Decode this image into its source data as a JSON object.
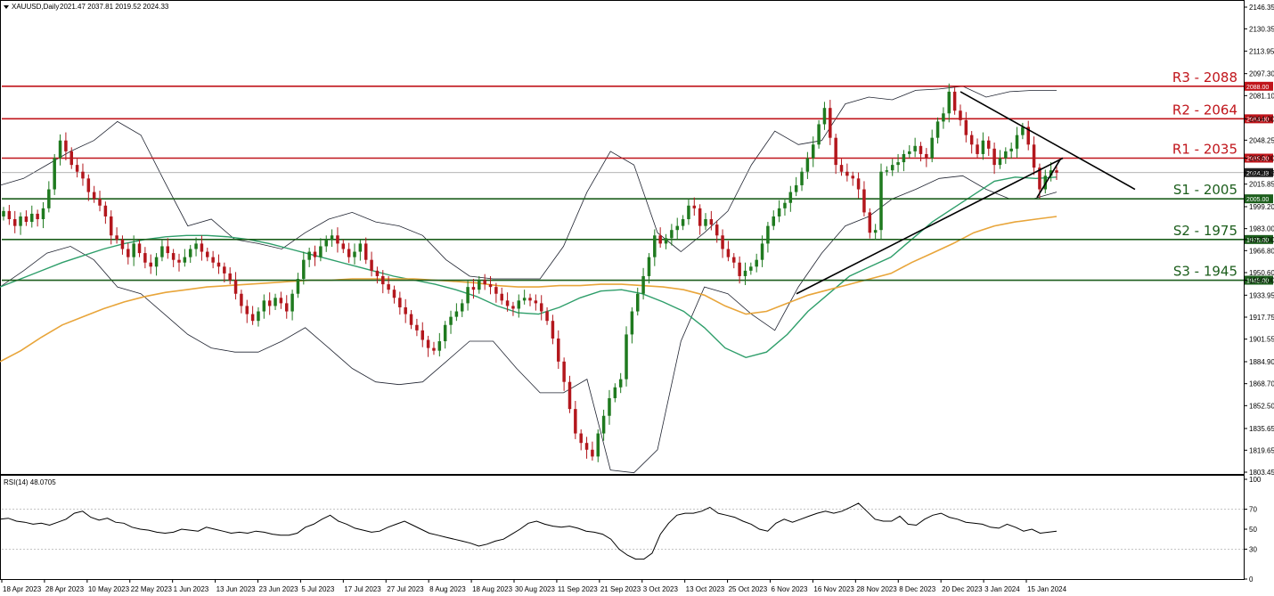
{
  "header": {
    "symbol": "XAUUSD,Daily",
    "ohlc": "2021.47 2037.81 2019.52 2024.33",
    "rsi_label": "RSI(14) 48.0705"
  },
  "colors": {
    "resistance": "#c0151b",
    "support": "#1c5e1c",
    "ma_green": "#2e9e6a",
    "ma_orange": "#e8a53a",
    "bollinger": "#1f2330",
    "bull": "#1f7a1f",
    "bear": "#b3171d",
    "last_price_bg": "#222222"
  },
  "chart_data": [
    {
      "type": "candlestick",
      "title": "XAUUSD,Daily",
      "ylim": [
        1803.45,
        2146.35
      ],
      "y_ticks": [
        "2146.35",
        "2130.35",
        "2113.95",
        "2097.30",
        "2081.10",
        "2064.00",
        "2048.25",
        "2035.00",
        "2024.33",
        "2015.85",
        "1999.20",
        "1983.00",
        "1975.00",
        "1966.80",
        "1950.60",
        "1945.00",
        "1933.95",
        "1917.75",
        "1901.55",
        "1884.90",
        "1868.70",
        "1852.50",
        "1835.65",
        "1819.65",
        "1803.45"
      ],
      "x_tick_labels": [
        "18 Apr 2023",
        "28 Apr 2023",
        "10 May 2023",
        "22 May 2023",
        "1 Jun 2023",
        "13 Jun 2023",
        "23 Jun 2023",
        "5 Jul 2023",
        "17 Jul 2023",
        "27 Jul 2023",
        "8 Aug 2023",
        "18 Aug 2023",
        "30 Aug 2023",
        "11 Sep 2023",
        "21 Sep 2023",
        "3 Oct 2023",
        "13 Oct 2023",
        "25 Oct 2023",
        "6 Nov 2023",
        "16 Nov 2023",
        "28 Nov 2023",
        "8 Dec 2023",
        "20 Dec 2023",
        "3 Jan 2024",
        "15 Jan 2024"
      ],
      "levels": [
        {
          "label": "R3 - 2088",
          "value": 2088,
          "badge": "2088.00",
          "kind": "resistance"
        },
        {
          "label": "R2 - 2064",
          "value": 2064,
          "badge": "2064.00",
          "kind": "resistance"
        },
        {
          "label": "R1 - 2035",
          "value": 2035,
          "badge": "2035.00",
          "kind": "resistance"
        },
        {
          "label": "S1 - 2005",
          "value": 2005,
          "badge": "2005.00",
          "kind": "support"
        },
        {
          "label": "S2 - 1975",
          "value": 1975,
          "badge": "1975.00",
          "kind": "support"
        },
        {
          "label": "S3 - 1945",
          "value": 1945,
          "badge": "1945.00",
          "kind": "support"
        }
      ],
      "last_price": 2024.33,
      "closes": [
        1996,
        1990,
        1985,
        1992,
        1988,
        1994,
        1990,
        1998,
        2012,
        2035,
        2048,
        2040,
        2030,
        2025,
        2020,
        2010,
        2005,
        2000,
        1992,
        1978,
        1975,
        1968,
        1962,
        1972,
        1965,
        1958,
        1955,
        1962,
        1970,
        1965,
        1960,
        1958,
        1962,
        1968,
        1972,
        1966,
        1962,
        1958,
        1955,
        1950,
        1945,
        1935,
        1926,
        1920,
        1915,
        1922,
        1930,
        1926,
        1932,
        1928,
        1922,
        1935,
        1946,
        1960,
        1966,
        1962,
        1970,
        1975,
        1978,
        1972,
        1968,
        1962,
        1966,
        1972,
        1960,
        1952,
        1948,
        1942,
        1938,
        1932,
        1925,
        1920,
        1912,
        1908,
        1901,
        1895,
        1893,
        1900,
        1912,
        1918,
        1922,
        1928,
        1940,
        1938,
        1945,
        1942,
        1940,
        1935,
        1930,
        1926,
        1924,
        1930,
        1932,
        1930,
        1928,
        1922,
        1915,
        1902,
        1885,
        1870,
        1850,
        1832,
        1825,
        1820,
        1815,
        1832,
        1845,
        1858,
        1866,
        1872,
        1905,
        1922,
        1935,
        1948,
        1962,
        1978,
        1972,
        1976,
        1982,
        1985,
        1990,
        2000,
        1998,
        1985,
        1990,
        1986,
        1978,
        1968,
        1962,
        1958,
        1948,
        1952,
        1955,
        1960,
        1972,
        1985,
        1992,
        1998,
        2002,
        2010,
        2015,
        2025,
        2035,
        2045,
        2060,
        2072,
        2050,
        2030,
        2025,
        2022,
        2020,
        2012,
        1995,
        1980,
        1982,
        2025,
        2026,
        2030,
        2032,
        2038,
        2040,
        2044,
        2038,
        2035,
        2050,
        2062,
        2068,
        2084,
        2070,
        2063,
        2052,
        2045,
        2038,
        2048,
        2042,
        2030,
        2035,
        2040,
        2042,
        2052,
        2058,
        2045,
        2028,
        2012,
        2022,
        2026,
        2024.33
      ],
      "ma_green": [
        1940,
        1946,
        1952,
        1958,
        1963,
        1968,
        1972,
        1975,
        1977,
        1978,
        1978,
        1977,
        1975,
        1972,
        1968,
        1964,
        1960,
        1956,
        1952,
        1948,
        1945,
        1942,
        1938,
        1933,
        1926,
        1921,
        1920,
        1925,
        1932,
        1937,
        1938,
        1935,
        1929,
        1922,
        1910,
        1895,
        1888,
        1892,
        1905,
        1922,
        1935,
        1948,
        1955,
        1962,
        1975,
        1988,
        1998,
        2008,
        2018,
        2021,
        2020,
        2021
      ],
      "ma_orange": [
        1885,
        1893,
        1903,
        1912,
        1918,
        1924,
        1929,
        1933,
        1936,
        1938,
        1940,
        1941,
        1942,
        1943,
        1944,
        1945,
        1945,
        1946,
        1946,
        1946,
        1946,
        1945,
        1944,
        1943,
        1941,
        1940,
        1940,
        1941,
        1941,
        1942,
        1942,
        1941,
        1940,
        1938,
        1934,
        1926,
        1920,
        1922,
        1928,
        1934,
        1938,
        1942,
        1946,
        1950,
        1958,
        1965,
        1972,
        1980,
        1985,
        1988,
        1990,
        1992
      ],
      "bb_upper": [
        2015,
        2020,
        2030,
        2040,
        2048,
        2062,
        2052,
        2018,
        1985,
        1990,
        1975,
        1972,
        1968,
        1980,
        1990,
        1995,
        1988,
        1985,
        1978,
        1960,
        1948,
        1946,
        1946,
        1946,
        1970,
        2010,
        2040,
        2030,
        1980,
        1966,
        1980,
        1996,
        2030,
        2055,
        2045,
        2048,
        2075,
        2080,
        2078,
        2085,
        2086,
        2088,
        2080,
        2084,
        2085,
        2085
      ],
      "bb_lower": [
        1940,
        1952,
        1965,
        1970,
        1960,
        1940,
        1935,
        1920,
        1905,
        1895,
        1892,
        1892,
        1900,
        1910,
        1895,
        1880,
        1870,
        1868,
        1870,
        1885,
        1900,
        1900,
        1880,
        1862,
        1862,
        1872,
        1805,
        1803,
        1820,
        1900,
        1940,
        1935,
        1920,
        1908,
        1940,
        1965,
        1985,
        1992,
        2005,
        2012,
        2020,
        2022,
        2012,
        2005,
        2005,
        2010
      ],
      "trendlines": [
        {
          "from": [
            2084,
            2070
          ],
          "to_value": 2012
        },
        {
          "from": [
            1935,
            1940
          ],
          "to_value": 2042
        }
      ]
    },
    {
      "type": "line",
      "title": "RSI(14) 48.0705",
      "ylim": [
        0,
        100
      ],
      "y_ticks": [
        "100",
        "70",
        "50",
        "30",
        "0"
      ],
      "values": [
        60,
        61,
        58,
        57,
        55,
        56,
        54,
        57,
        60,
        66,
        68,
        62,
        59,
        61,
        57,
        56,
        52,
        50,
        49,
        47,
        46,
        47,
        50,
        49,
        48,
        52,
        50,
        48,
        46,
        47,
        46,
        48,
        47,
        45,
        44,
        44,
        46,
        52,
        55,
        60,
        64,
        58,
        55,
        51,
        49,
        47,
        48,
        52,
        55,
        58,
        54,
        50,
        46,
        44,
        42,
        40,
        38,
        36,
        33,
        35,
        38,
        40,
        45,
        50,
        56,
        58,
        55,
        53,
        52,
        53,
        51,
        48,
        47,
        45,
        40,
        30,
        24,
        20,
        20,
        26,
        45,
        56,
        64,
        66,
        66,
        68,
        72,
        66,
        64,
        62,
        58,
        55,
        50,
        48,
        56,
        60,
        57,
        60,
        63,
        66,
        68,
        66,
        68,
        72,
        76,
        68,
        60,
        58,
        58,
        63,
        55,
        54,
        60,
        64,
        66,
        62,
        60,
        57,
        56,
        55,
        52,
        51,
        55,
        52,
        48,
        50,
        46,
        47,
        48
      ]
    }
  ]
}
